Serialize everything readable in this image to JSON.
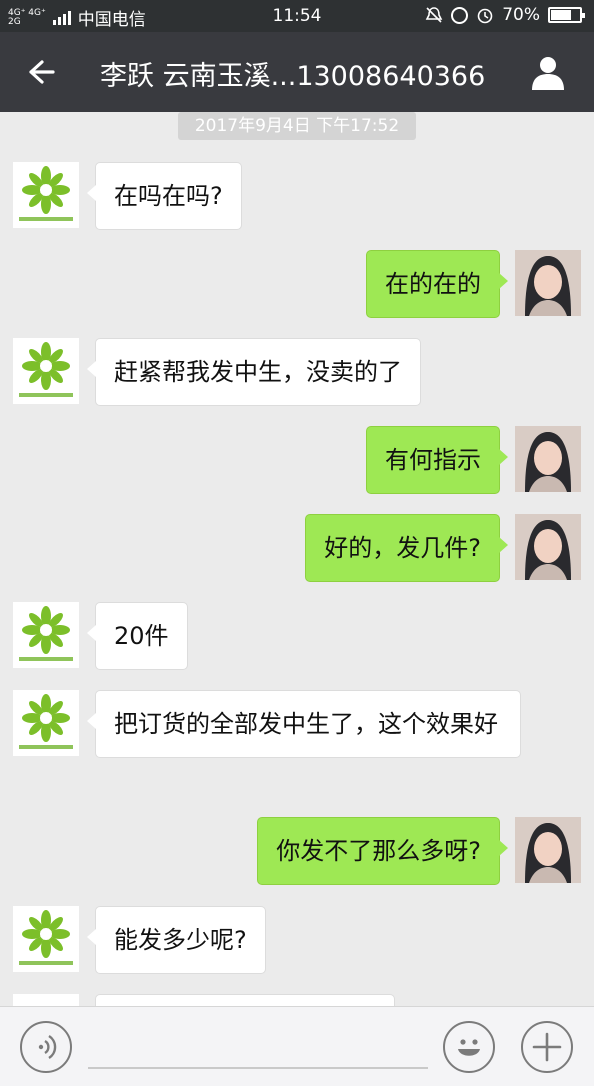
{
  "status_bar": {
    "network_top": "4G⁺ 4G⁺",
    "network_bottom": "2G",
    "carrier": "中国电信",
    "time": "11:54",
    "battery": "70%",
    "battery_level": 0.7
  },
  "header": {
    "title": "李跃 云南玉溪...13008640366"
  },
  "chat": {
    "timestamp": "2017年9月4日 下午17:52",
    "messages": [
      {
        "side": "left",
        "text": "在吗在吗?"
      },
      {
        "side": "right",
        "text": "在的在的"
      },
      {
        "side": "left",
        "text": "赶紧帮我发中生，没卖的了"
      },
      {
        "side": "right",
        "text": "有何指示"
      },
      {
        "side": "right",
        "text": "好的，发几件?"
      },
      {
        "side": "left",
        "text": "20件"
      },
      {
        "side": "left",
        "text": "把订货的全部发中生了，这个效果好"
      },
      {
        "side": "right",
        "text": "你发不了那么多呀?"
      },
      {
        "side": "left",
        "text": "能发多少呢?"
      }
    ]
  },
  "icons": {
    "back": "arrow-left-icon",
    "profile": "person-icon",
    "voice": "voice-icon",
    "emoji": "emoji-icon",
    "plus": "plus-icon"
  },
  "colors": {
    "header_bg": "#393a3f",
    "chat_bg": "#ebebeb",
    "sent_bubble": "#9ee854",
    "received_bubble": "#ffffff"
  }
}
